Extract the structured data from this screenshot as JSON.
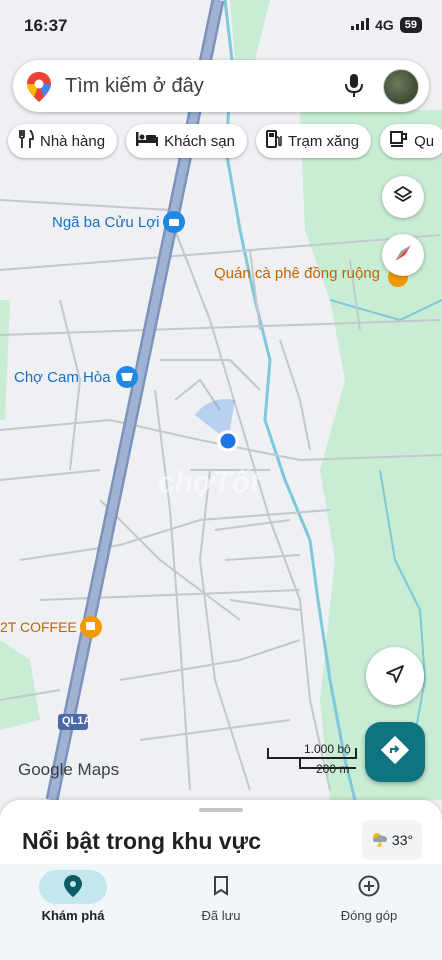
{
  "status_bar": {
    "time": "16:37",
    "network": "4G",
    "battery": "59"
  },
  "search": {
    "placeholder": "Tìm kiếm ở đây"
  },
  "chips": [
    {
      "label": "Nhà hàng",
      "icon": "restaurant-icon"
    },
    {
      "label": "Khách sạn",
      "icon": "hotel-icon"
    },
    {
      "label": "Trạm xăng",
      "icon": "gas-station-icon"
    },
    {
      "label": "Qu",
      "icon": "coffee-icon"
    }
  ],
  "map": {
    "labels": {
      "nga_ba": "Ngã ba Cửu Lợi",
      "quan_ca_phe": "Quán cà phê đồng ruộng",
      "cho_cam_hoa": "Chợ Cam Hòa",
      "coffee_2t": "2T COFFEE",
      "road_shield": "QL1A",
      "attribution": "Google Maps",
      "watermark": "chợTốt"
    },
    "scale": {
      "imperial": "1.000 bộ",
      "metric": "200 m"
    }
  },
  "sheet": {
    "title": "Nổi bật trong khu vực",
    "temperature": "33°"
  },
  "bottom_nav": [
    {
      "label": "Khám phá",
      "icon": "explore-icon",
      "active": true
    },
    {
      "label": "Đã lưu",
      "icon": "bookmark-icon",
      "active": false
    },
    {
      "label": "Đóng góp",
      "icon": "add-circle-icon",
      "active": false
    }
  ],
  "colors": {
    "accent": "#0e7480",
    "highway": "#8a9fc2",
    "water": "#7fc8d9",
    "park": "#c9ecd4",
    "location": "#1a73e8"
  }
}
